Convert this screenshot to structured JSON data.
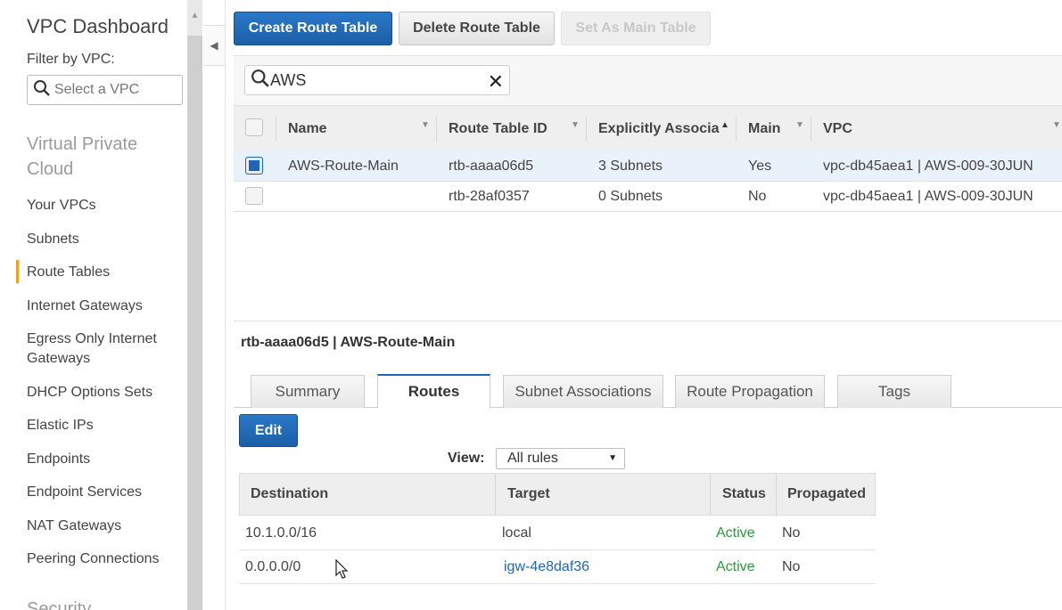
{
  "sidebar": {
    "title": "VPC Dashboard",
    "filter_label": "Filter by VPC:",
    "select_placeholder": "Select a VPC",
    "section_vpc": "Virtual Private Cloud",
    "items": [
      {
        "label": "Your VPCs"
      },
      {
        "label": "Subnets"
      },
      {
        "label": "Route Tables"
      },
      {
        "label": "Internet Gateways"
      },
      {
        "label": "Egress Only Internet Gateways"
      },
      {
        "label": "DHCP Options Sets"
      },
      {
        "label": "Elastic IPs"
      },
      {
        "label": "Endpoints"
      },
      {
        "label": "Endpoint Services"
      },
      {
        "label": "NAT Gateways"
      },
      {
        "label": "Peering Connections"
      }
    ],
    "section_security": "Security",
    "active_item": "Route Tables",
    "active_color": "#f0a020"
  },
  "toolbar": {
    "create_label": "Create Route Table",
    "delete_label": "Delete Route Table",
    "set_main_label": "Set As Main Table"
  },
  "search": {
    "value": "AWS"
  },
  "grid": {
    "columns": [
      "Name",
      "Route Table ID",
      "Explicitly Associa",
      "Main",
      "VPC"
    ],
    "rows": [
      {
        "name": "AWS-Route-Main",
        "id": "rtb-aaaa06d5",
        "assoc": "3 Subnets",
        "main": "Yes",
        "vpc": "vpc-db45aea1 | AWS-009-30JUN",
        "selected": true
      },
      {
        "name": "",
        "id": "rtb-28af0357",
        "assoc": "0 Subnets",
        "main": "No",
        "vpc": "vpc-db45aea1 | AWS-009-30JUN",
        "selected": false
      }
    ]
  },
  "details": {
    "title": "rtb-aaaa06d5 | AWS-Route-Main",
    "tabs": [
      "Summary",
      "Routes",
      "Subnet Associations",
      "Route Propagation",
      "Tags"
    ],
    "active_tab": "Routes",
    "edit_label": "Edit",
    "view_label": "View:",
    "view_value": "All rules",
    "routes_columns": [
      "Destination",
      "Target",
      "Status",
      "Propagated"
    ],
    "routes": [
      {
        "destination": "10.1.0.0/16",
        "target": "local",
        "status": "Active",
        "propagated": "No"
      },
      {
        "destination": "0.0.0.0/0",
        "target": "igw-4e8daf36",
        "status": "Active",
        "propagated": "No"
      }
    ],
    "status_color": "#2b9a3a",
    "link_color": "#1f66b8"
  },
  "icons": {
    "search": "search-icon",
    "clear": "close-icon",
    "collapse": "chevron-left-icon",
    "caret": "caret-down-icon"
  },
  "colors": {
    "primary": "#1f66b8"
  }
}
